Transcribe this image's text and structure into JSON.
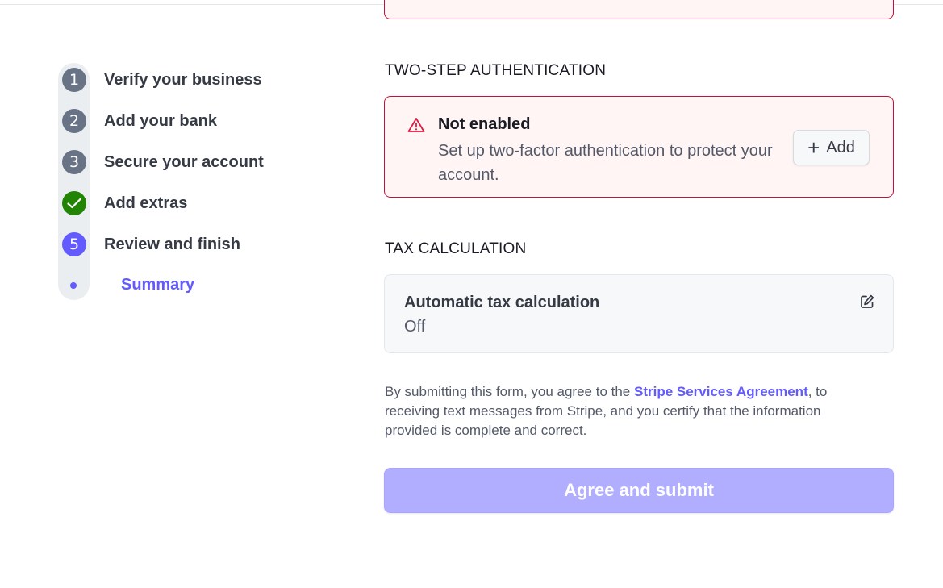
{
  "stepper": {
    "steps": [
      {
        "number": "1",
        "label": "Verify your business",
        "state": "incomplete"
      },
      {
        "number": "2",
        "label": "Add your bank",
        "state": "incomplete"
      },
      {
        "number": "3",
        "label": "Secure your account",
        "state": "incomplete"
      },
      {
        "number": "",
        "label": "Add extras",
        "state": "complete"
      },
      {
        "number": "5",
        "label": "Review and finish",
        "state": "current"
      }
    ],
    "sub_step": {
      "label": "Summary"
    }
  },
  "two_step": {
    "heading": "TWO-STEP AUTHENTICATION",
    "status_title": "Not enabled",
    "status_text": "Set up two-factor authentication to protect your account.",
    "add_label": "Add",
    "icon": "warning-triangle-icon"
  },
  "tax": {
    "heading": "TAX CALCULATION",
    "title": "Automatic tax calculation",
    "value": "Off",
    "icon": "edit-icon"
  },
  "legal": {
    "prefix": "By submitting this form, you agree to the ",
    "link": "Stripe Services Agreement",
    "suffix": ", to receiving text messages from Stripe, and you certify that the information provided is complete and correct."
  },
  "submit": {
    "label": "Agree and submit"
  },
  "colors": {
    "accent": "#635bff",
    "success": "#228403",
    "danger": "#c0123c",
    "step_gray": "#687385",
    "submit_disabled": "#b1adff"
  }
}
